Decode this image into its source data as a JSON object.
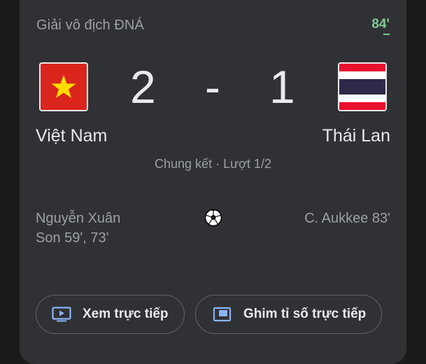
{
  "header": {
    "league": "Giải vô địch ĐNÁ",
    "minute": "84'"
  },
  "match": {
    "home": {
      "name": "Việt Nam",
      "score": "2",
      "flag_icon": "vietnam-flag-icon",
      "scorers_line1": "Nguyễn Xuân",
      "scorers_line2": "Son 59', 73'"
    },
    "separator": "-",
    "away": {
      "name": "Thái Lan",
      "score": "1",
      "flag_icon": "thailand-flag-icon",
      "scorers_line1": "C. Aukkee 83'"
    },
    "stage": "Chung kết · Lượt 1/2"
  },
  "actions": {
    "watch_live": "Xem trực tiếp",
    "pin_score": "Ghim tỉ số trực tiếp"
  },
  "colors": {
    "card_bg": "#303134",
    "live_green": "#81c995",
    "text_primary": "#e8eaed",
    "text_secondary": "#9aa0a6",
    "icon_blue": "#8ab4f8"
  }
}
